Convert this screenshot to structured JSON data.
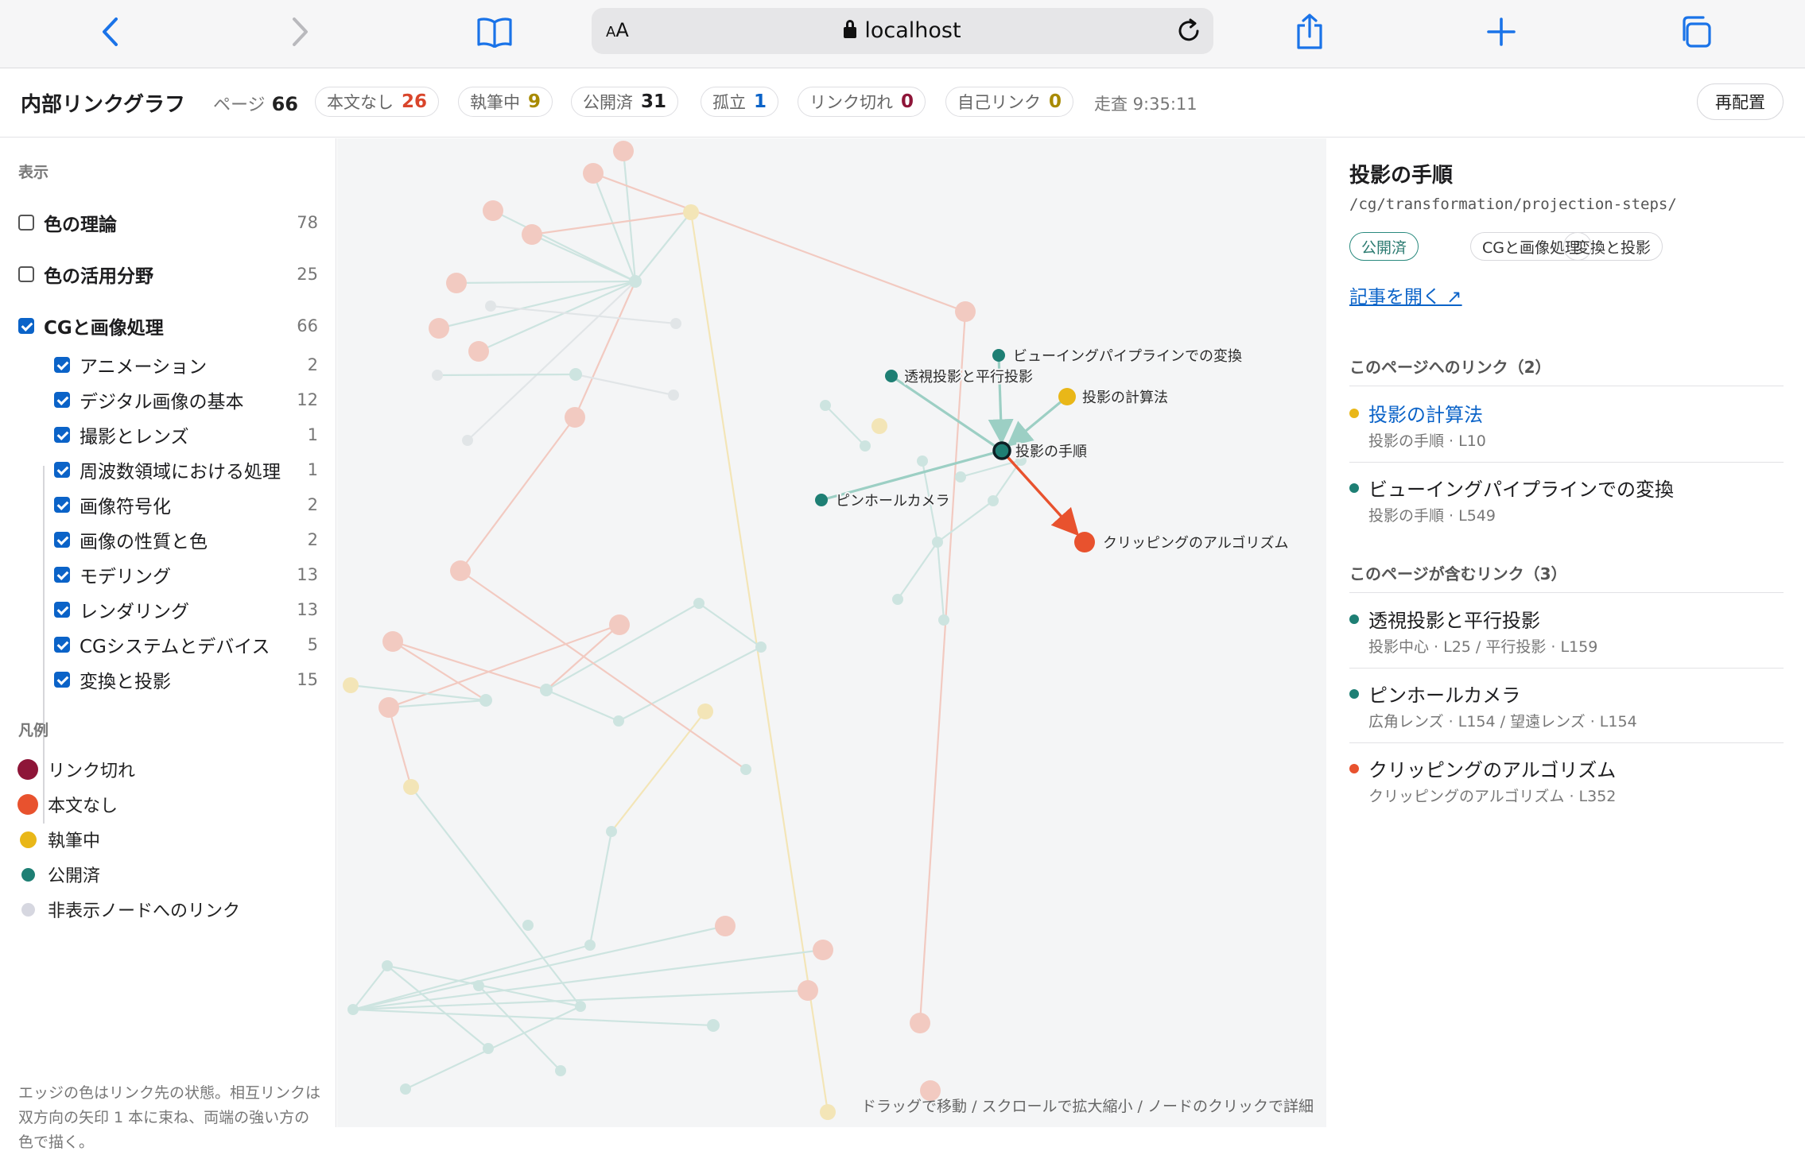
{
  "browser": {
    "url": "localhost",
    "aa_big": "A",
    "aa_small": "A"
  },
  "header": {
    "title": "内部リンクグラフ",
    "pages_label": "ページ",
    "pages_value": "66",
    "pills": [
      {
        "label": "本文なし",
        "value": "26",
        "color": "#d9452b"
      },
      {
        "label": "執筆中",
        "value": "9",
        "color": "#a88a00"
      },
      {
        "label": "公開済",
        "value": "31",
        "color": "#1d1d1f"
      },
      {
        "label": "孤立",
        "value": "1",
        "color": "#0b63c8"
      },
      {
        "label": "リンク切れ",
        "value": "0",
        "color": "#8e1538"
      },
      {
        "label": "自己リンク",
        "value": "0",
        "color": "#a88a00"
      }
    ],
    "scan_text": "走査 9:35:11",
    "relayout_label": "再配置"
  },
  "sidebar": {
    "display_label": "表示",
    "top_items": [
      {
        "label": "色の理論",
        "count": "78",
        "checked": false
      },
      {
        "label": "色の活用分野",
        "count": "25",
        "checked": false
      },
      {
        "label": "CGと画像処理",
        "count": "66",
        "checked": true
      }
    ],
    "sub_items": [
      {
        "label": "アニメーション",
        "count": "2"
      },
      {
        "label": "デジタル画像の基本",
        "count": "12"
      },
      {
        "label": "撮影とレンズ",
        "count": "1"
      },
      {
        "label": "周波数領域における処理",
        "count": "1"
      },
      {
        "label": "画像符号化",
        "count": "2"
      },
      {
        "label": "画像の性質と色",
        "count": "2"
      },
      {
        "label": "モデリング",
        "count": "13"
      },
      {
        "label": "レンダリング",
        "count": "13"
      },
      {
        "label": "CGシステムとデバイス",
        "count": "5"
      },
      {
        "label": "変換と投影",
        "count": "15"
      }
    ],
    "legend_label": "凡例",
    "legend": [
      {
        "label": "リンク切れ",
        "color": "#8e1538"
      },
      {
        "label": "本文なし",
        "color": "#e8522e"
      },
      {
        "label": "執筆中",
        "color": "#e9b718"
      },
      {
        "label": "公開済",
        "color": "#1e7f74"
      },
      {
        "label": "非表示ノードへのリンク",
        "color": "#d6d7e0"
      }
    ],
    "note": "エッジの色はリンク先の状態。相互リンクは双方向の矢印 1 本に束ね、両端の強い方の色で描く。"
  },
  "graph": {
    "hint": "ドラッグで移動 / スクロールで拡大縮小 / ノードのクリックで詳細",
    "focus_labels": [
      "ビューイングパイプラインでの変換",
      "透視投影と平行投影",
      "投影の計算法",
      "投影の手順",
      "ピンホールカメラ",
      "クリッピングのアルゴリズム"
    ]
  },
  "detail": {
    "title": "投影の手順",
    "path": "/cg/transformation/projection-steps/",
    "tags": [
      "公開済",
      "CGと画像処理",
      "変換と投影"
    ],
    "open_link": "記事を開く ↗",
    "incoming_header": "このページへのリンク（2）",
    "incoming": [
      {
        "name": "投影の計算法",
        "sub": "投影の手順 · L10",
        "color": "#e9b718",
        "link": true
      },
      {
        "name": "ビューイングパイプラインでの変換",
        "sub": "投影の手順 · L549",
        "color": "#1e7f74",
        "link": false
      }
    ],
    "outgoing_header": "このページが含むリンク（3）",
    "outgoing": [
      {
        "name": "透視投影と平行投影",
        "sub": "投影中心 · L25 / 平行投影 · L159",
        "color": "#1e7f74"
      },
      {
        "name": "ピンホールカメラ",
        "sub": "広角レンズ · L154 / 望遠レンズ · L154",
        "color": "#1e7f74"
      },
      {
        "name": "クリッピングのアルゴリズム",
        "sub": "クリッピングのアルゴリズム · L352",
        "color": "#e8522e"
      }
    ]
  }
}
